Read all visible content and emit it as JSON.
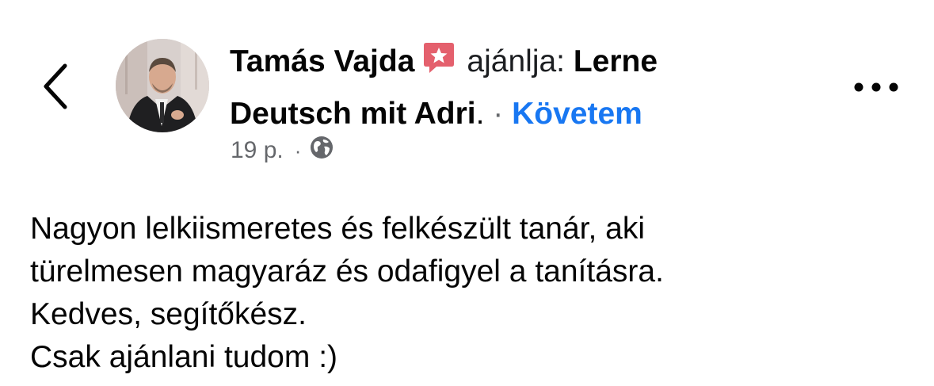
{
  "header": {
    "author_name": "Tamás Vajda",
    "action_text": "ajánlja:",
    "page_name": "Lerne Deutsch mit Adri",
    "page_name_suffix": ".",
    "separator": "·",
    "follow_label": "Követem"
  },
  "meta": {
    "time": "19 p.",
    "separator": "·",
    "audience_icon": "globe-icon"
  },
  "icons": {
    "back": "chevron-left-icon",
    "badge": "recommendation-star-icon",
    "more": "more-options-icon"
  },
  "colors": {
    "follow_link": "#1877f2",
    "secondary_text": "#65676b",
    "badge": "#e4606d"
  },
  "post": {
    "lines": [
      "Nagyon lelkiismeretes és felkészült tanár, aki",
      "türelmesen magyaráz és odafigyel a tanításra.",
      "Kedves, segítőkész.",
      "Csak ajánlani tudom :)"
    ]
  }
}
